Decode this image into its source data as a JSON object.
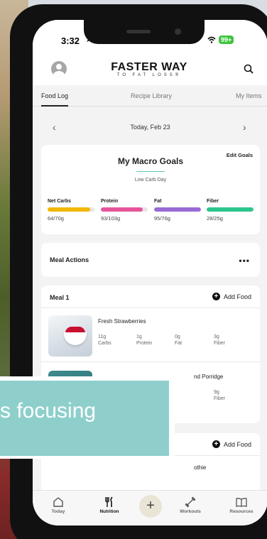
{
  "status": {
    "time": "3:32",
    "location_glyph": "➤",
    "battery": "99+"
  },
  "header": {
    "logo_main": "FASTER WAY",
    "logo_sub": "TO FAT LOSS®"
  },
  "tabs": [
    {
      "label": "Food Log"
    },
    {
      "label": "Recipe Library"
    },
    {
      "label": "My Items"
    }
  ],
  "date": {
    "label": "Today, Feb 23",
    "prev": "‹",
    "next": "›"
  },
  "macro": {
    "title": "My Macro Goals",
    "edit": "Edit Goals",
    "subtitle": "Low Carb Day",
    "items": [
      {
        "name": "Net Carbs",
        "value": "64/70g",
        "progress": 0.91,
        "color": "#f2b705"
      },
      {
        "name": "Protein",
        "value": "93/103g",
        "progress": 0.9,
        "color": "#e5559b"
      },
      {
        "name": "Fat",
        "value": "95/76g",
        "progress": 1.0,
        "color": "#9a6bd6"
      },
      {
        "name": "Fiber",
        "value": "28/25g",
        "progress": 1.0,
        "color": "#2cc68b"
      }
    ]
  },
  "meal_actions": {
    "label": "Meal Actions",
    "more": "•••"
  },
  "meal1": {
    "title": "Meal 1",
    "add": "Add Food",
    "foods": [
      {
        "name": "Fresh Strawberries",
        "carbs": "11g",
        "carbs_label": "Carbs",
        "protein": "1g",
        "protein_label": "Protein",
        "fat": "0g",
        "fat_label": "Fat",
        "fiber": "3g",
        "fiber_label": "Fiber"
      },
      {
        "name": "nd Porridge",
        "fiber": "9g",
        "fiber_label": "Fiber"
      }
    ]
  },
  "meal2": {
    "add": "Add Food",
    "food_name": "othie"
  },
  "overlay": {
    "text": "s focusing"
  },
  "nav": [
    {
      "label": "Today"
    },
    {
      "label": "Nutrition"
    },
    {
      "label": "Workouts"
    },
    {
      "label": "Resources"
    }
  ]
}
